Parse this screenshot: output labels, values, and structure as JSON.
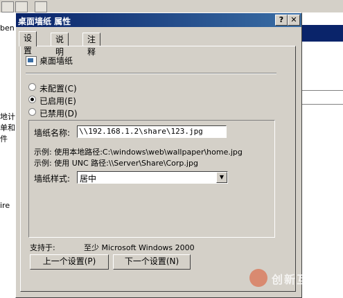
{
  "background": {
    "left_fragments": [
      "ben",
      "地计",
      "单和",
      "件",
      "ire"
    ]
  },
  "dialog": {
    "title": "桌面墙纸 属性",
    "help_button": "?",
    "close_button": "✕",
    "tabs": [
      {
        "label": "设置",
        "active": true
      },
      {
        "label": "说明",
        "active": false
      },
      {
        "label": "注释",
        "active": false
      }
    ],
    "policy_name": "桌面墙纸",
    "options": [
      {
        "label": "未配置(C)",
        "checked": false
      },
      {
        "label": "已启用(E)",
        "checked": true
      },
      {
        "label": "已禁用(D)",
        "checked": false
      }
    ],
    "wallpaper_name_label": "墙纸名称:",
    "wallpaper_name_value": "\\\\192.168.1.2\\share\\123.jpg",
    "example_local": "示例: 使用本地路径:C:\\windows\\web\\wallpaper\\home.jpg",
    "example_unc": "示例: 使用 UNC 路径:\\\\Server\\Share\\Corp.jpg",
    "style_label": "墙纸样式:",
    "style_value": "居中",
    "supported_label": "支持于:",
    "supported_value": "至少 Microsoft Windows 2000",
    "prev_button": "上一个设置(P)",
    "next_button": "下一个设置(N)"
  },
  "watermark": {
    "text": "创新互联"
  },
  "colors": {
    "titlebar": "#0a246a",
    "face": "#d4d0c8"
  }
}
